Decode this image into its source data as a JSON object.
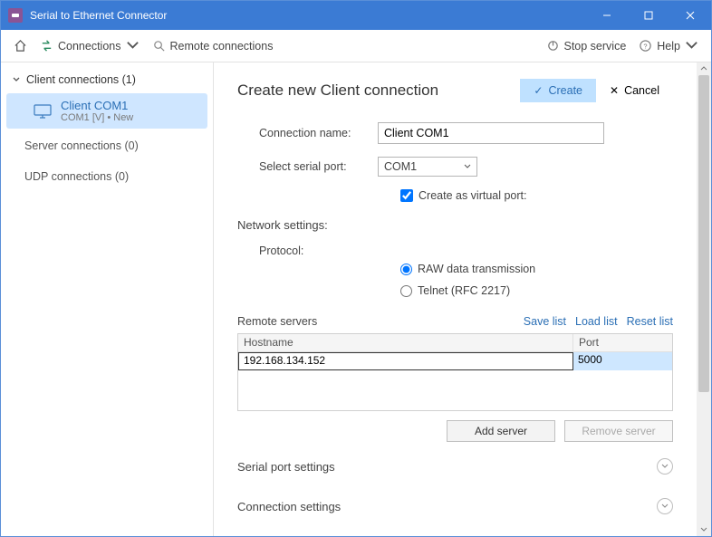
{
  "titlebar": {
    "title": "Serial to Ethernet Connector"
  },
  "toolbar": {
    "connections_label": "Connections",
    "remote_label": "Remote connections",
    "stop_service_label": "Stop service",
    "help_label": "Help"
  },
  "sidebar": {
    "groups": {
      "client": {
        "label": "Client connections (1)"
      },
      "server": {
        "label": "Server connections (0)"
      },
      "udp": {
        "label": "UDP connections (0)"
      }
    },
    "client_item": {
      "name": "Client COM1",
      "sub": "COM1 [V] • New"
    }
  },
  "main": {
    "title": "Create new Client connection",
    "create_btn": "Create",
    "cancel_btn": "Cancel",
    "labels": {
      "connection_name": "Connection name:",
      "select_port": "Select serial port:",
      "virtual_port": "Create as virtual port:",
      "network_settings": "Network settings:",
      "protocol": "Protocol:",
      "raw": "RAW data transmission",
      "telnet": "Telnet (RFC 2217)",
      "remote_servers": "Remote servers",
      "save_list": "Save list",
      "load_list": "Load list",
      "reset_list": "Reset list",
      "hostname": "Hostname",
      "port": "Port",
      "add_server": "Add server",
      "remove_server": "Remove server",
      "serial_port_settings": "Serial port settings",
      "connection_settings": "Connection settings"
    },
    "values": {
      "connection_name": "Client COM1",
      "serial_port": "COM1",
      "virtual_checked": true,
      "protocol": "raw",
      "server_host": "192.168.134.152",
      "server_port": "5000"
    }
  }
}
